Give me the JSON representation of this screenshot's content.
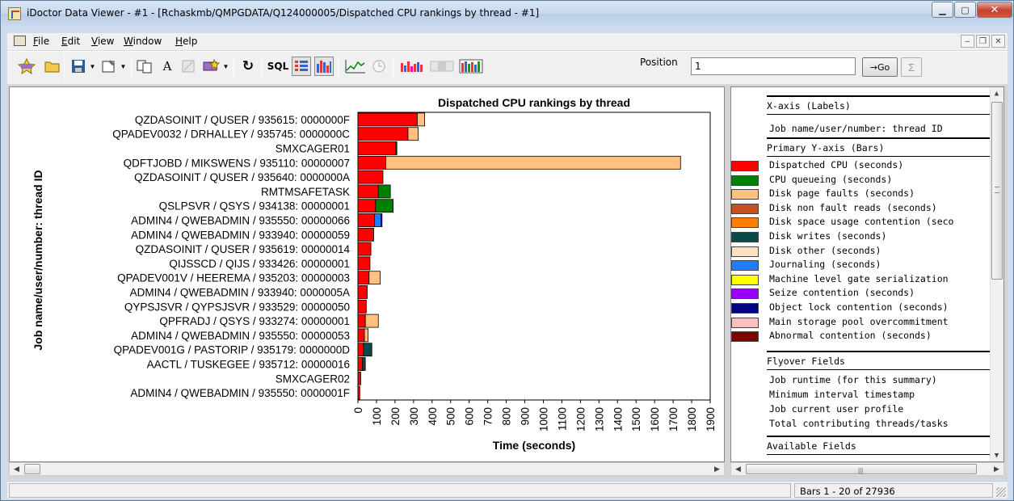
{
  "window": {
    "title": "iDoctor Data Viewer - #1 - [Rchaskmb/QMPGDATA/Q124000005/Dispatched CPU rankings by thread  - #1]"
  },
  "menu": [
    "File",
    "Edit",
    "View",
    "Window",
    "Help"
  ],
  "toolbar": {
    "sql_label": "SQL",
    "position_label": "Position",
    "position_value": "1",
    "go_label": "→Go",
    "sum_label": "Σ"
  },
  "chart_data": {
    "type": "bar",
    "orientation": "horizontal",
    "stacked": true,
    "title": "Dispatched CPU rankings by thread",
    "xlabel": "Time (seconds)",
    "ylabel": "Job name/user/number: thread ID",
    "xlim": [
      0,
      1900
    ],
    "xticks": [
      "0",
      "100",
      "200",
      "300",
      "400",
      "500",
      "600",
      "700",
      "800",
      "900",
      "1000",
      "1100",
      "1200",
      "1300",
      "1400",
      "1500",
      "1600",
      "1700",
      "1800",
      "1900"
    ],
    "categories": [
      "QZDASOINIT / QUSER / 935615: 0000000F",
      "QPADEV0032 / DRHALLEY / 935745: 0000000C",
      "SMXCAGER01",
      "QDFTJOBD / MIKSWENS / 935110: 00000007",
      "QZDASOINIT / QUSER / 935640: 0000000A",
      "RMTMSAFETASK",
      "QSLPSVR / QSYS / 934138: 00000001",
      "ADMIN4 / QWEBADMIN / 935550: 00000066",
      "ADMIN4 / QWEBADMIN / 933940: 00000059",
      "QZDASOINIT / QUSER / 935619: 00000014",
      "QIJSSCD / QIJS / 933426: 00000001",
      "QPADEV001V / HEEREMA / 935203: 00000003",
      "ADMIN4 / QWEBADMIN / 933940: 0000005A",
      "QYPSJSVR / QYPSJSVR / 933529: 00000050",
      "QPFRADJ / QSYS / 933274: 00000001",
      "ADMIN4 / QWEBADMIN / 935550: 00000053",
      "QPADEV001G / PASTORIP / 935179: 0000000D",
      "AACTL / TUSKEGEE / 935712: 00000016",
      "SMXCAGER02",
      "ADMIN4 / QWEBADMIN / 935550: 0000001F"
    ],
    "series": [
      {
        "name": "Dispatched CPU (seconds)",
        "color": "#ff0000",
        "values": [
          320,
          270,
          205,
          150,
          135,
          110,
          95,
          90,
          85,
          70,
          65,
          60,
          50,
          45,
          40,
          35,
          30,
          25,
          15,
          10
        ]
      },
      {
        "name": "CPU queueing (seconds)",
        "color": "#008000",
        "values": [
          0,
          0,
          5,
          0,
          0,
          65,
          95,
          0,
          0,
          0,
          0,
          0,
          0,
          0,
          0,
          0,
          0,
          0,
          0,
          0
        ]
      },
      {
        "name": "Disk page faults (seconds)",
        "color": "#ffc080",
        "values": [
          40,
          55,
          0,
          1590,
          0,
          0,
          0,
          0,
          0,
          0,
          0,
          60,
          0,
          0,
          70,
          20,
          0,
          0,
          0,
          0
        ]
      },
      {
        "name": "Disk writes (seconds)",
        "color": "#0a4a4a",
        "values": [
          0,
          0,
          0,
          0,
          0,
          0,
          0,
          0,
          0,
          0,
          0,
          0,
          0,
          0,
          0,
          0,
          45,
          15,
          0,
          0
        ]
      },
      {
        "name": "Journaling (seconds)",
        "color": "#1e7cff",
        "values": [
          0,
          0,
          0,
          0,
          0,
          0,
          0,
          35,
          0,
          0,
          0,
          0,
          0,
          0,
          0,
          0,
          0,
          0,
          0,
          0
        ]
      },
      {
        "name": "Seize contention (seconds)",
        "color": "#9900ff",
        "values": [
          0,
          0,
          0,
          0,
          0,
          0,
          0,
          5,
          0,
          0,
          0,
          0,
          0,
          0,
          0,
          0,
          0,
          0,
          0,
          0
        ]
      }
    ]
  },
  "legend": {
    "xaxis_header": "X-axis (Labels)",
    "xaxis_field": "Job name/user/number: thread ID",
    "yaxis_header": "Primary Y-axis (Bars)",
    "items": [
      {
        "label": "Dispatched CPU (seconds)",
        "color": "#ff0000"
      },
      {
        "label": "CPU queueing (seconds)",
        "color": "#008000"
      },
      {
        "label": "Disk page faults (seconds)",
        "color": "#ffc080"
      },
      {
        "label": "Disk non fault reads (seconds)",
        "color": "#c8501e"
      },
      {
        "label": "Disk space usage contention (seco",
        "color": "#ff8000"
      },
      {
        "label": "Disk writes (seconds)",
        "color": "#0a4a4a"
      },
      {
        "label": "Disk other (seconds)",
        "color": "#ffe0c0"
      },
      {
        "label": "Journaling (seconds)",
        "color": "#1e7cff"
      },
      {
        "label": "Machine level gate serialization",
        "color": "#ffff00"
      },
      {
        "label": "Seize contention (seconds)",
        "color": "#9900ff"
      },
      {
        "label": "Object lock contention (seconds)",
        "color": "#000080"
      },
      {
        "label": "Main storage pool overcommitment",
        "color": "#ffc0c0"
      },
      {
        "label": "Abnormal contention (seconds)",
        "color": "#800000"
      }
    ],
    "flyover_header": "Flyover Fields",
    "flyover_items": [
      "Job runtime (for this summary)",
      "Minimum interval timestamp",
      "Job current user profile",
      "Total contributing threads/tasks"
    ],
    "available_header": "Available Fields"
  },
  "status": {
    "left": "",
    "right": "Bars 1 - 20 of 27936"
  }
}
